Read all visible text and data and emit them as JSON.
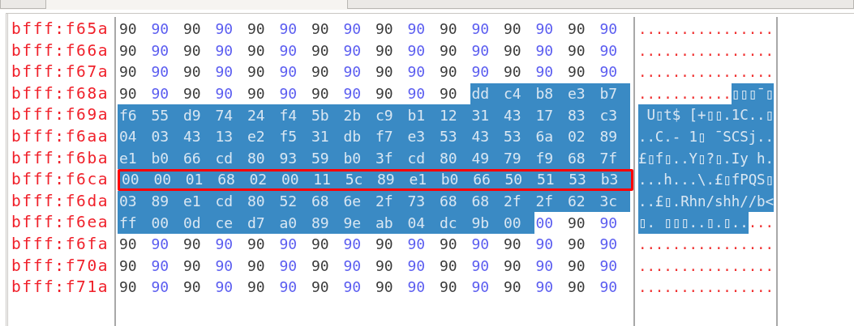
{
  "rows": [
    {
      "address": "bfff:f65a",
      "highlighted": false,
      "bytes": [
        {
          "value": "90",
          "selected": false
        },
        {
          "value": "90",
          "selected": false
        },
        {
          "value": "90",
          "selected": false
        },
        {
          "value": "90",
          "selected": false
        },
        {
          "value": "90",
          "selected": false
        },
        {
          "value": "90",
          "selected": false
        },
        {
          "value": "90",
          "selected": false
        },
        {
          "value": "90",
          "selected": false
        },
        {
          "value": "90",
          "selected": false
        },
        {
          "value": "90",
          "selected": false
        },
        {
          "value": "90",
          "selected": false
        },
        {
          "value": "90",
          "selected": false
        },
        {
          "value": "90",
          "selected": false
        },
        {
          "value": "90",
          "selected": false
        },
        {
          "value": "90",
          "selected": false
        },
        {
          "value": "90",
          "selected": false
        }
      ],
      "ascii": [
        {
          "text": "................",
          "selected": false
        }
      ]
    },
    {
      "address": "bfff:f66a",
      "highlighted": false,
      "bytes": [
        {
          "value": "90",
          "selected": false
        },
        {
          "value": "90",
          "selected": false
        },
        {
          "value": "90",
          "selected": false
        },
        {
          "value": "90",
          "selected": false
        },
        {
          "value": "90",
          "selected": false
        },
        {
          "value": "90",
          "selected": false
        },
        {
          "value": "90",
          "selected": false
        },
        {
          "value": "90",
          "selected": false
        },
        {
          "value": "90",
          "selected": false
        },
        {
          "value": "90",
          "selected": false
        },
        {
          "value": "90",
          "selected": false
        },
        {
          "value": "90",
          "selected": false
        },
        {
          "value": "90",
          "selected": false
        },
        {
          "value": "90",
          "selected": false
        },
        {
          "value": "90",
          "selected": false
        },
        {
          "value": "90",
          "selected": false
        }
      ],
      "ascii": [
        {
          "text": "................",
          "selected": false
        }
      ]
    },
    {
      "address": "bfff:f67a",
      "highlighted": false,
      "bytes": [
        {
          "value": "90",
          "selected": false
        },
        {
          "value": "90",
          "selected": false
        },
        {
          "value": "90",
          "selected": false
        },
        {
          "value": "90",
          "selected": false
        },
        {
          "value": "90",
          "selected": false
        },
        {
          "value": "90",
          "selected": false
        },
        {
          "value": "90",
          "selected": false
        },
        {
          "value": "90",
          "selected": false
        },
        {
          "value": "90",
          "selected": false
        },
        {
          "value": "90",
          "selected": false
        },
        {
          "value": "90",
          "selected": false
        },
        {
          "value": "90",
          "selected": false
        },
        {
          "value": "90",
          "selected": false
        },
        {
          "value": "90",
          "selected": false
        },
        {
          "value": "90",
          "selected": false
        },
        {
          "value": "90",
          "selected": false
        }
      ],
      "ascii": [
        {
          "text": "................",
          "selected": false
        }
      ]
    },
    {
      "address": "bfff:f68a",
      "highlighted": false,
      "bytes": [
        {
          "value": "90",
          "selected": false
        },
        {
          "value": "90",
          "selected": false
        },
        {
          "value": "90",
          "selected": false
        },
        {
          "value": "90",
          "selected": false
        },
        {
          "value": "90",
          "selected": false
        },
        {
          "value": "90",
          "selected": false
        },
        {
          "value": "90",
          "selected": false
        },
        {
          "value": "90",
          "selected": false
        },
        {
          "value": "90",
          "selected": false
        },
        {
          "value": "90",
          "selected": false
        },
        {
          "value": "90",
          "selected": false
        },
        {
          "value": "dd",
          "selected": true
        },
        {
          "value": "c4",
          "selected": true
        },
        {
          "value": "b8",
          "selected": true
        },
        {
          "value": "e3",
          "selected": true
        },
        {
          "value": "b7",
          "selected": true
        }
      ],
      "ascii": [
        {
          "text": "...........",
          "selected": false
        },
        {
          "text": "▯▯▯¯▯",
          "selected": true
        }
      ]
    },
    {
      "address": "bfff:f69a",
      "highlighted": false,
      "bytes": [
        {
          "value": "f6",
          "selected": true
        },
        {
          "value": "55",
          "selected": true
        },
        {
          "value": "d9",
          "selected": true
        },
        {
          "value": "74",
          "selected": true
        },
        {
          "value": "24",
          "selected": true
        },
        {
          "value": "f4",
          "selected": true
        },
        {
          "value": "5b",
          "selected": true
        },
        {
          "value": "2b",
          "selected": true
        },
        {
          "value": "c9",
          "selected": true
        },
        {
          "value": "b1",
          "selected": true
        },
        {
          "value": "12",
          "selected": true
        },
        {
          "value": "31",
          "selected": true
        },
        {
          "value": "43",
          "selected": true
        },
        {
          "value": "17",
          "selected": true
        },
        {
          "value": "83",
          "selected": true
        },
        {
          "value": "c3",
          "selected": true
        }
      ],
      "ascii": [
        {
          "text": " U▯t$ [+▯▯.1C..▯",
          "selected": true
        }
      ]
    },
    {
      "address": "bfff:f6aa",
      "highlighted": false,
      "bytes": [
        {
          "value": "04",
          "selected": true
        },
        {
          "value": "03",
          "selected": true
        },
        {
          "value": "43",
          "selected": true
        },
        {
          "value": "13",
          "selected": true
        },
        {
          "value": "e2",
          "selected": true
        },
        {
          "value": "f5",
          "selected": true
        },
        {
          "value": "31",
          "selected": true
        },
        {
          "value": "db",
          "selected": true
        },
        {
          "value": "f7",
          "selected": true
        },
        {
          "value": "e3",
          "selected": true
        },
        {
          "value": "53",
          "selected": true
        },
        {
          "value": "43",
          "selected": true
        },
        {
          "value": "53",
          "selected": true
        },
        {
          "value": "6a",
          "selected": true
        },
        {
          "value": "02",
          "selected": true
        },
        {
          "value": "89",
          "selected": true
        }
      ],
      "ascii": [
        {
          "text": "..C.- 1▯ ¯SCSj..",
          "selected": true
        }
      ]
    },
    {
      "address": "bfff:f6ba",
      "highlighted": false,
      "bytes": [
        {
          "value": "e1",
          "selected": true
        },
        {
          "value": "b0",
          "selected": true
        },
        {
          "value": "66",
          "selected": true
        },
        {
          "value": "cd",
          "selected": true
        },
        {
          "value": "80",
          "selected": true
        },
        {
          "value": "93",
          "selected": true
        },
        {
          "value": "59",
          "selected": true
        },
        {
          "value": "b0",
          "selected": true
        },
        {
          "value": "3f",
          "selected": true
        },
        {
          "value": "cd",
          "selected": true
        },
        {
          "value": "80",
          "selected": true
        },
        {
          "value": "49",
          "selected": true
        },
        {
          "value": "79",
          "selected": true
        },
        {
          "value": "f9",
          "selected": true
        },
        {
          "value": "68",
          "selected": true
        },
        {
          "value": "7f",
          "selected": true
        }
      ],
      "ascii": [
        {
          "text": "£▯f▯..Y▯?▯.Iy h.",
          "selected": true
        }
      ]
    },
    {
      "address": "bfff:f6ca",
      "highlighted": true,
      "bytes": [
        {
          "value": "00",
          "selected": true
        },
        {
          "value": "00",
          "selected": true
        },
        {
          "value": "01",
          "selected": true
        },
        {
          "value": "68",
          "selected": true
        },
        {
          "value": "02",
          "selected": true
        },
        {
          "value": "00",
          "selected": true
        },
        {
          "value": "11",
          "selected": true
        },
        {
          "value": "5c",
          "selected": true
        },
        {
          "value": "89",
          "selected": true
        },
        {
          "value": "e1",
          "selected": true
        },
        {
          "value": "b0",
          "selected": true
        },
        {
          "value": "66",
          "selected": true
        },
        {
          "value": "50",
          "selected": true
        },
        {
          "value": "51",
          "selected": true
        },
        {
          "value": "53",
          "selected": true
        },
        {
          "value": "b3",
          "selected": true
        }
      ],
      "ascii": [
        {
          "text": "...h...\\.£▯fPQS▯",
          "selected": true
        }
      ]
    },
    {
      "address": "bfff:f6da",
      "highlighted": false,
      "bytes": [
        {
          "value": "03",
          "selected": true
        },
        {
          "value": "89",
          "selected": true
        },
        {
          "value": "e1",
          "selected": true
        },
        {
          "value": "cd",
          "selected": true
        },
        {
          "value": "80",
          "selected": true
        },
        {
          "value": "52",
          "selected": true
        },
        {
          "value": "68",
          "selected": true
        },
        {
          "value": "6e",
          "selected": true
        },
        {
          "value": "2f",
          "selected": true
        },
        {
          "value": "73",
          "selected": true
        },
        {
          "value": "68",
          "selected": true
        },
        {
          "value": "68",
          "selected": true
        },
        {
          "value": "2f",
          "selected": true
        },
        {
          "value": "2f",
          "selected": true
        },
        {
          "value": "62",
          "selected": true
        },
        {
          "value": "3c",
          "selected": true
        }
      ],
      "ascii": [
        {
          "text": "..£▯.Rhn/shh//b<",
          "selected": true
        }
      ]
    },
    {
      "address": "bfff:f6ea",
      "highlighted": false,
      "bytes": [
        {
          "value": "ff",
          "selected": true
        },
        {
          "value": "00",
          "selected": true
        },
        {
          "value": "0d",
          "selected": true
        },
        {
          "value": "ce",
          "selected": true
        },
        {
          "value": "d7",
          "selected": true
        },
        {
          "value": "a0",
          "selected": true
        },
        {
          "value": "89",
          "selected": true
        },
        {
          "value": "9e",
          "selected": true
        },
        {
          "value": "ab",
          "selected": true
        },
        {
          "value": "04",
          "selected": true
        },
        {
          "value": "dc",
          "selected": true
        },
        {
          "value": "9b",
          "selected": true
        },
        {
          "value": "00",
          "selected": true
        },
        {
          "value": "00",
          "selected": false
        },
        {
          "value": "90",
          "selected": false
        },
        {
          "value": "90",
          "selected": false
        }
      ],
      "ascii": [
        {
          "text": "▯. ▯▯▯..▯.▯..",
          "selected": true
        },
        {
          "text": "...",
          "selected": false
        }
      ]
    },
    {
      "address": "bfff:f6fa",
      "highlighted": false,
      "bytes": [
        {
          "value": "90",
          "selected": false
        },
        {
          "value": "90",
          "selected": false
        },
        {
          "value": "90",
          "selected": false
        },
        {
          "value": "90",
          "selected": false
        },
        {
          "value": "90",
          "selected": false
        },
        {
          "value": "90",
          "selected": false
        },
        {
          "value": "90",
          "selected": false
        },
        {
          "value": "90",
          "selected": false
        },
        {
          "value": "90",
          "selected": false
        },
        {
          "value": "90",
          "selected": false
        },
        {
          "value": "90",
          "selected": false
        },
        {
          "value": "90",
          "selected": false
        },
        {
          "value": "90",
          "selected": false
        },
        {
          "value": "90",
          "selected": false
        },
        {
          "value": "90",
          "selected": false
        },
        {
          "value": "90",
          "selected": false
        }
      ],
      "ascii": [
        {
          "text": "................",
          "selected": false
        }
      ]
    },
    {
      "address": "bfff:f70a",
      "highlighted": false,
      "bytes": [
        {
          "value": "90",
          "selected": false
        },
        {
          "value": "90",
          "selected": false
        },
        {
          "value": "90",
          "selected": false
        },
        {
          "value": "90",
          "selected": false
        },
        {
          "value": "90",
          "selected": false
        },
        {
          "value": "90",
          "selected": false
        },
        {
          "value": "90",
          "selected": false
        },
        {
          "value": "90",
          "selected": false
        },
        {
          "value": "90",
          "selected": false
        },
        {
          "value": "90",
          "selected": false
        },
        {
          "value": "90",
          "selected": false
        },
        {
          "value": "90",
          "selected": false
        },
        {
          "value": "90",
          "selected": false
        },
        {
          "value": "90",
          "selected": false
        },
        {
          "value": "90",
          "selected": false
        },
        {
          "value": "90",
          "selected": false
        }
      ],
      "ascii": [
        {
          "text": "................",
          "selected": false
        }
      ]
    },
    {
      "address": "bfff:f71a",
      "highlighted": false,
      "bytes": [
        {
          "value": "90",
          "selected": false
        },
        {
          "value": "90",
          "selected": false
        },
        {
          "value": "90",
          "selected": false
        },
        {
          "value": "90",
          "selected": false
        },
        {
          "value": "90",
          "selected": false
        },
        {
          "value": "90",
          "selected": false
        },
        {
          "value": "90",
          "selected": false
        },
        {
          "value": "90",
          "selected": false
        },
        {
          "value": "90",
          "selected": false
        },
        {
          "value": "90",
          "selected": false
        },
        {
          "value": "90",
          "selected": false
        },
        {
          "value": "90",
          "selected": false
        },
        {
          "value": "90",
          "selected": false
        },
        {
          "value": "90",
          "selected": false
        },
        {
          "value": "90",
          "selected": false
        },
        {
          "value": "90",
          "selected": false
        }
      ],
      "ascii": [
        {
          "text": "................",
          "selected": false
        }
      ]
    }
  ]
}
